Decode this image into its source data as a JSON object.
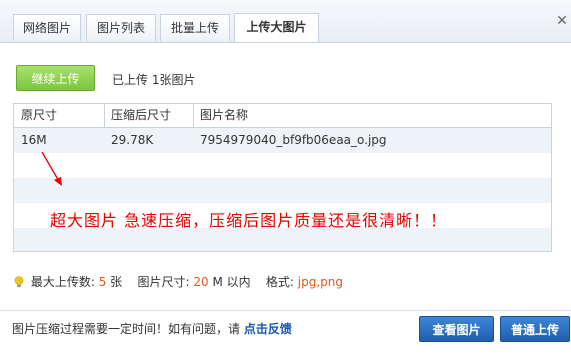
{
  "tabs": [
    {
      "label": "网络图片"
    },
    {
      "label": "图片列表"
    },
    {
      "label": "批量上传"
    },
    {
      "label": "上传大图片",
      "active": true
    }
  ],
  "continue_button": "继续上传",
  "uploaded_count": "已上传 1张图片",
  "table": {
    "headers": [
      "原尺寸",
      "压缩后尺寸",
      "图片名称"
    ],
    "rows": [
      [
        "16M",
        "29.78K",
        "7954979040_bf9fb06eaa_o.jpg"
      ]
    ]
  },
  "annotation": "超大图片  急速压缩，压缩后图片质量还是很清晰！！",
  "limits": {
    "max_count_label": "最大上传数:",
    "max_count_value": "5",
    "max_count_unit": "张",
    "size_label": "图片尺寸:",
    "size_value": "20",
    "size_unit": "M 以内",
    "format_label": "格式:",
    "format_value": "jpg,png"
  },
  "footer": {
    "tip": "图片压缩过程需要一定时间！如有问题，请",
    "feedback_link": "点击反馈",
    "view_button": "查看图片",
    "normal_upload_button": "普通上传"
  },
  "colors": {
    "accent": "#1e5fae",
    "green_button": "#7cc63d",
    "annotation": "#e60000",
    "highlight": "#e05a1f"
  },
  "icons": [
    "close-icon",
    "bulb-icon",
    "arrow-icon"
  ]
}
